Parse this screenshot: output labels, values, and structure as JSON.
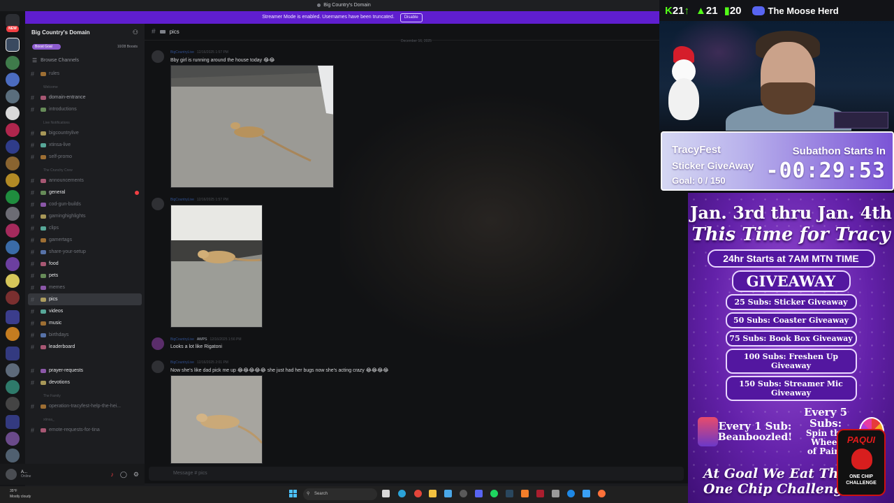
{
  "window": {
    "title": "Big Country's Domain"
  },
  "banner": {
    "text": "Streamer Mode is enabled. Usernames have been truncated.",
    "action": "Disable"
  },
  "server_rail": {
    "new_badge": "NEW"
  },
  "sidebar": {
    "server_name": "Big Country's Domain",
    "boost_goal": "Boost Goal",
    "boost_count": "10/28 Boosts",
    "browse_channels": "Browse Channels",
    "items": [
      {
        "kind": "channel",
        "label": "rules",
        "tone": "dim"
      },
      {
        "kind": "category",
        "label": "Welcome"
      },
      {
        "kind": "channel",
        "label": "domain-entrance",
        "tone": "mid"
      },
      {
        "kind": "channel",
        "label": "introductions",
        "tone": "dim"
      },
      {
        "kind": "category",
        "label": "Live Notifications"
      },
      {
        "kind": "channel",
        "label": "bigcountrylive",
        "tone": "dim"
      },
      {
        "kind": "channel",
        "label": "xtinsa-live",
        "tone": "dim"
      },
      {
        "kind": "channel",
        "label": "self-promo",
        "tone": "dim"
      },
      {
        "kind": "category",
        "label": "The Crunchy Crew"
      },
      {
        "kind": "channel",
        "label": "announcements",
        "tone": "dim"
      },
      {
        "kind": "channel",
        "label": "general",
        "tone": "bright",
        "badge": true
      },
      {
        "kind": "channel",
        "label": "cod-gun-builds",
        "tone": "dim"
      },
      {
        "kind": "channel",
        "label": "gaminghighlights",
        "tone": "dim"
      },
      {
        "kind": "channel",
        "label": "clips",
        "tone": "dim"
      },
      {
        "kind": "channel",
        "label": "gamertags",
        "tone": "dim"
      },
      {
        "kind": "channel",
        "label": "share-your-setup",
        "tone": "dim"
      },
      {
        "kind": "channel",
        "label": "food",
        "tone": "bright"
      },
      {
        "kind": "channel",
        "label": "pets",
        "tone": "bright"
      },
      {
        "kind": "channel",
        "label": "memes",
        "tone": "dim"
      },
      {
        "kind": "channel",
        "label": "pics",
        "tone": "active"
      },
      {
        "kind": "channel",
        "label": "videos",
        "tone": "bright"
      },
      {
        "kind": "channel",
        "label": "music",
        "tone": "bright"
      },
      {
        "kind": "channel",
        "label": "birthdays",
        "tone": "dim"
      },
      {
        "kind": "channel",
        "label": "leaderboard",
        "tone": "bright"
      },
      {
        "kind": "category",
        "label": ""
      },
      {
        "kind": "channel",
        "label": "prayer-requests",
        "tone": "bright"
      },
      {
        "kind": "channel",
        "label": "devotions",
        "tone": "bright"
      },
      {
        "kind": "category",
        "label": "The Family"
      },
      {
        "kind": "channel",
        "label": "operation-tracyfest-help-the-hei...",
        "tone": "dim"
      },
      {
        "kind": "category",
        "label": "xtinsa_"
      },
      {
        "kind": "channel",
        "label": "emote-requests-for-tina",
        "tone": "dim"
      }
    ]
  },
  "user_panel": {
    "name": "A...",
    "status": "Online"
  },
  "chat": {
    "channel": "pics",
    "date_divider": "December 16, 2025",
    "messages": [
      {
        "author": "BigCountryLive",
        "time": "12/16/2025 1:57 PM",
        "text": "Bby girl is running around the house today 😂😂"
      },
      {
        "author": "BigCountryLive",
        "time": "12/16/2025 1:57 PM",
        "text": ""
      },
      {
        "author": "BigCountryLive",
        "time": "12/16/2025 1:56 PM",
        "text": "Looks a lot like Rigatoni",
        "tag": "AWPS"
      },
      {
        "author": "BigCountryLive",
        "time": "12/16/2025 2:01 PM",
        "text": "Now she's like dad pick me up 😂😂😂😂😂 she just had her bugs now she's acting crazy 😂😂😂😂"
      }
    ],
    "composer_placeholder": "Message # pics"
  },
  "taskbar": {
    "weather_temp": "35°F",
    "weather_desc": "Mostly cloudy",
    "search_placeholder": "Search"
  },
  "overlay": {
    "stats": {
      "kick": "21",
      "climb": "21",
      "bars": "20"
    },
    "discord_name": "The Moose Herd",
    "timer": {
      "title": "TracyFest",
      "subtitle": "Sticker GiveAway",
      "goal": "Goal: 0 / 150",
      "label": "Subathon Starts In",
      "countdown": "-00:29:53"
    },
    "promo": {
      "dates": "Jan. 3rd thru Jan. 4th",
      "tagline": "This Time for Tracy",
      "hours": "24hr Starts at 7AM MTN TIME",
      "giveaway": "GIVEAWAY",
      "tiers": [
        "25 Subs: Sticker Giveaway",
        "50 Subs: Coaster Giveaway",
        "75 Subs: Book Box Giveaway",
        "100 Subs: Freshen Up Giveaway",
        "150 Subs: Streamer Mic Giveaway"
      ],
      "every1_a": "Every 1 Sub:",
      "every1_b": "Beanboozled!",
      "every5_a": "Every 5 Subs:",
      "every5_b": "Spin the Wheel",
      "every5_c": "of Pain!",
      "goal_line1": "At Goal We Eat The",
      "goal_line2": "One Chip Challenge!",
      "paqui_brand": "PAQUI",
      "paqui_sub1": "ONE CHIP",
      "paqui_sub2": "CHALLENGE"
    }
  },
  "colors": {
    "discord_bg": "#111214",
    "banner": "#5f1ecf",
    "kick_green": "#53fc18",
    "promo_purple": "#6321a9"
  }
}
